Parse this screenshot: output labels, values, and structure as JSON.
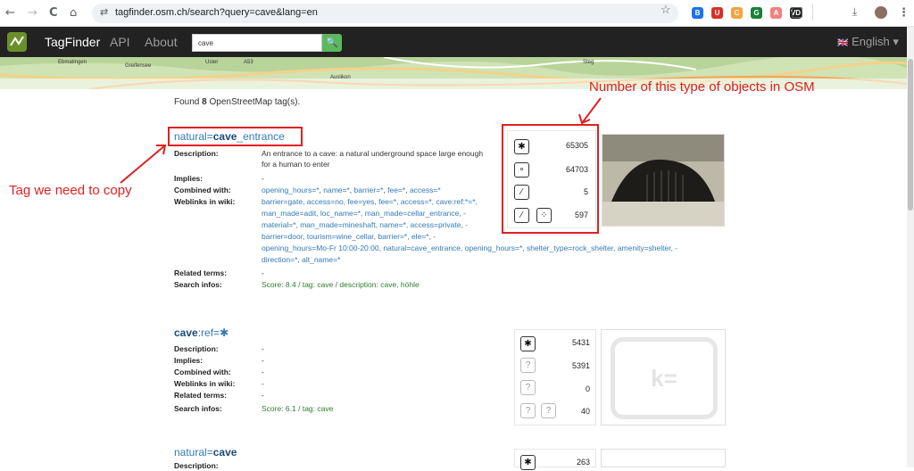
{
  "browser": {
    "nav_back": "←",
    "nav_forward": "→",
    "reload": "C",
    "home": "⌂",
    "site_info": "⇄",
    "url": "tagfinder.osm.ch/search?query=cave&lang=en",
    "star": "☆",
    "menu": "⋮",
    "extensions": [
      {
        "name": "ext-1",
        "color": "#1a73e8",
        "text": "B"
      },
      {
        "name": "ext-2",
        "color": "#d93025",
        "text": "U"
      },
      {
        "name": "ext-3",
        "color": "#f4a340",
        "text": "C"
      },
      {
        "name": "ext-4",
        "color": "#188038",
        "text": "G"
      },
      {
        "name": "ext-5",
        "color": "#f08080",
        "text": "A"
      },
      {
        "name": "ext-6",
        "color": "#202124",
        "text": "VD"
      }
    ]
  },
  "navbar": {
    "brand": "TagFinder",
    "api": "API",
    "about": "About",
    "search_value": "cave",
    "search_button": "🔍",
    "language": "English",
    "flag": "🇬🇧",
    "caret": "▾"
  },
  "map_labels": [
    "Ebmatingen",
    "Greifensee",
    "Uster",
    "A53",
    "Auslikon",
    "Steg"
  ],
  "found_text_pre": "Found ",
  "found_count": "8",
  "found_text_post": " OpenStreetMap tag(s).",
  "results": [
    {
      "key": "natural",
      "eq": "=",
      "highlight": "cave",
      "suffix": "_entrance",
      "description_label": "Description:",
      "description": "An entrance to a cave: a natural underground space large enough for a human to enter",
      "implies_label": "Implies:",
      "implies": "-",
      "combined_label": "Combined with:",
      "combined": [
        "opening_hours=*",
        "name=*",
        "barrier=*",
        "fee=*",
        "access=*"
      ],
      "weblinks_label": "Weblinks in wiki:",
      "weblinks_l1": "barrier=gate, access=no, fee=yes, fee=*, access=*, cave:ref:*=*,",
      "weblinks_l2": "man_made=adit, loc_name=*, man_made=cellar_entrance, -",
      "weblinks_l3": "material=*, man_made=mineshaft, name=*, access=private, -",
      "weblinks_l4": "barrier=door, tourism=wine_cellar, barrier=*, ele=*, -",
      "weblinks_l5": "opening_hours=Mo-Fr 10:00-20:00, natural=cave_entrance, opening_hours=*, shelter_type=rock_shelter, amenity=shelter, -",
      "weblinks_l6": "direction=*, alt_name=*",
      "related_label": "Related terms:",
      "related": "-",
      "search_label": "Search infos:",
      "search": "Score: 8.4 / tag: cave / description: cave, höhle",
      "counts": [
        "65305",
        "64703",
        "5",
        "597"
      ]
    },
    {
      "key": "cave",
      "eq": ":ref=",
      "star": "✱",
      "description_label": "Description:",
      "description": "-",
      "implies_label": "Implies:",
      "implies": "-",
      "combined_label": "Combined with:",
      "combined": "-",
      "weblinks_label": "Weblinks in wiki:",
      "weblinks": "-",
      "related_label": "Related terms:",
      "related": "-",
      "search_label": "Search infos:",
      "search": "Score: 6.1 / tag: cave",
      "counts": [
        "5431",
        "5391",
        "0",
        "40"
      ],
      "placeholder": "k="
    },
    {
      "key": "natural",
      "eq": "=",
      "highlight": "cave",
      "description_label": "Description:",
      "counts": [
        "263"
      ]
    }
  ],
  "annotations": {
    "count_note": "Number of this type of objects in OSM",
    "tag_note": "Tag we need to copy",
    "color": "#e02020"
  }
}
